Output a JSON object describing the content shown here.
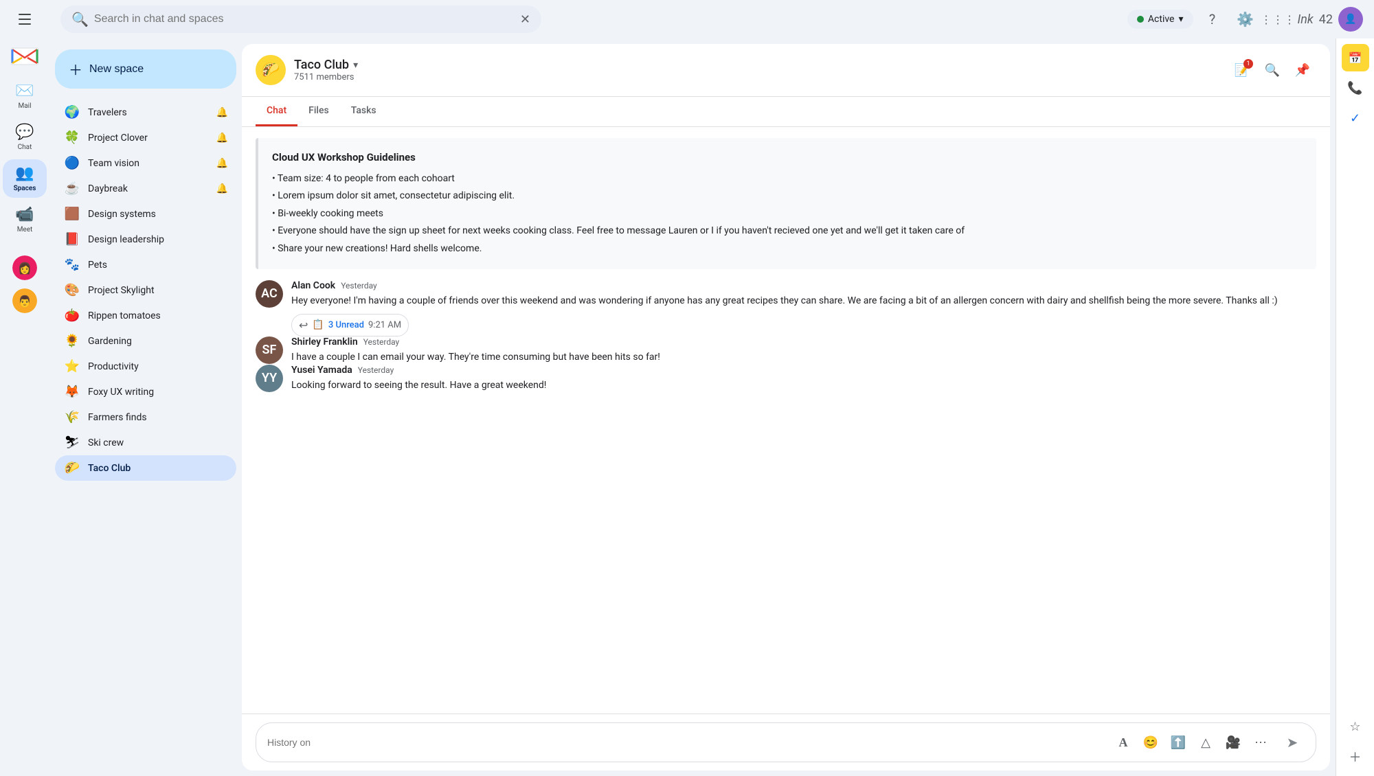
{
  "app": {
    "title": "Gmail",
    "hamburger_label": "menu"
  },
  "topbar": {
    "search_placeholder": "Search in chat and spaces",
    "status": "Active",
    "status_color": "#1e8e3e",
    "help_icon": "?",
    "settings_icon": "⚙",
    "ink_label": "Ink",
    "number_label": "42"
  },
  "nav": {
    "items": [
      {
        "id": "mail",
        "label": "Mail",
        "icon": "✉",
        "active": false
      },
      {
        "id": "chat",
        "label": "Chat",
        "icon": "💬",
        "active": false
      },
      {
        "id": "spaces",
        "label": "Spaces",
        "icon": "👥",
        "active": true
      },
      {
        "id": "meet",
        "label": "Meet",
        "icon": "📹",
        "active": false
      }
    ],
    "avatar1_color": "#e91e63",
    "avatar2_color": "#f9a825"
  },
  "sidebar": {
    "new_space_label": "New space",
    "items": [
      {
        "id": "travelers",
        "name": "Travelers",
        "emoji": "🌍",
        "bell": true,
        "active": false
      },
      {
        "id": "project-clover",
        "name": "Project Clover",
        "emoji": "🍀",
        "bell": true,
        "active": false
      },
      {
        "id": "team-vision",
        "name": "Team vision",
        "emoji": "🔵",
        "bell": true,
        "active": false
      },
      {
        "id": "daybreak",
        "name": "Daybreak",
        "emoji": "☕",
        "bell": true,
        "active": false
      },
      {
        "id": "design-systems",
        "name": "Design systems",
        "emoji": "🟫",
        "bell": false,
        "active": false
      },
      {
        "id": "design-leadership",
        "name": "Design leadership",
        "emoji": "📕",
        "bell": false,
        "active": false
      },
      {
        "id": "pets",
        "name": "Pets",
        "emoji": "🐾",
        "bell": false,
        "active": false
      },
      {
        "id": "project-skylight",
        "name": "Project Skylight",
        "emoji": "🎨",
        "bell": false,
        "active": false
      },
      {
        "id": "rippen-tomatoes",
        "name": "Rippen tomatoes",
        "emoji": "🍅",
        "bell": false,
        "active": false
      },
      {
        "id": "gardening",
        "name": "Gardening",
        "emoji": "🌻",
        "bell": false,
        "active": false
      },
      {
        "id": "productivity",
        "name": "Productivity",
        "emoji": "⭐",
        "bell": false,
        "active": false
      },
      {
        "id": "foxy-ux-writing",
        "name": "Foxy UX writing",
        "emoji": "🦊",
        "bell": false,
        "active": false
      },
      {
        "id": "farmers-finds",
        "name": "Farmers finds",
        "emoji": "🌾",
        "bell": false,
        "active": false
      },
      {
        "id": "ski-crew",
        "name": "Ski crew",
        "emoji": "⛷",
        "bell": false,
        "active": false
      },
      {
        "id": "taco-club",
        "name": "Taco Club",
        "emoji": "🌮",
        "bell": false,
        "active": true
      }
    ]
  },
  "chat_header": {
    "space_emoji": "🌮",
    "space_name": "Taco Club",
    "space_members": "7511 members",
    "notification_count": "1"
  },
  "tabs": [
    {
      "id": "chat",
      "label": "Chat",
      "active": true
    },
    {
      "id": "files",
      "label": "Files",
      "active": false
    },
    {
      "id": "tasks",
      "label": "Tasks",
      "active": false
    }
  ],
  "workshop_card": {
    "title": "Cloud UX Workshop Guidelines",
    "items": [
      "Team size: 4 to people from each cohoart",
      "Lorem ipsum dolor sit amet, consectetur adipiscing elit.",
      "Bi-weekly cooking meets",
      "Everyone should have the sign up sheet for next weeks cooking class. Feel free to message Lauren or I if you haven't recieved one yet and we'll get it taken care of",
      "Share your new creations! Hard shells welcome."
    ]
  },
  "messages": [
    {
      "id": "alan-cook",
      "sender": "Alan Cook",
      "time": "Yesterday",
      "text": "Hey everyone! I'm having a couple of friends over this weekend and was wondering if anyone has any great recipes they can share. We are facing a bit of an allergen concern with dairy and shellfish being the more severe. Thanks all :)",
      "avatar_color": "#5d4037",
      "avatar_initials": "AC",
      "has_thread": true,
      "thread_label": "3 Unread",
      "thread_time": "9:21 AM"
    },
    {
      "id": "shirley-franklin",
      "sender": "Shirley Franklin",
      "time": "Yesterday",
      "text": "I have a couple I can email your way. They're time consuming but have been hits so far!",
      "avatar_color": "#795548",
      "avatar_initials": "SF",
      "has_thread": false
    },
    {
      "id": "yusei-yamada",
      "sender": "Yusei Yamada",
      "time": "Yesterday",
      "text": "Looking forward to seeing the result. Have a great weekend!",
      "avatar_color": "#607d8b",
      "avatar_initials": "YY",
      "has_thread": false
    }
  ],
  "input": {
    "placeholder": "History on",
    "icons": [
      "A",
      "😊",
      "⬆",
      "△",
      "🎥",
      "⋯"
    ]
  },
  "right_sidebar": {
    "icons": [
      "calendar",
      "phone",
      "check",
      "star",
      "plus"
    ]
  }
}
